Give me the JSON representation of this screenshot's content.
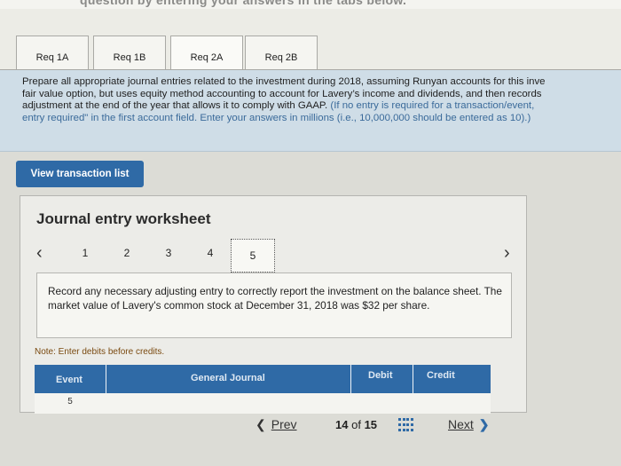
{
  "top_banner": {
    "text": "question by entering your answers in the tabs below."
  },
  "tabs": [
    {
      "label": "Req 1A"
    },
    {
      "label": "Req 1B"
    },
    {
      "label": "Req 2A"
    },
    {
      "label": "Req 2B"
    }
  ],
  "instructions": {
    "line1": "Prepare all appropriate journal entries related to the investment during 2018, assuming Runyan accounts for this inve",
    "line2": "fair value option, but uses equity method accounting to account for Lavery’s income and dividends, and then records",
    "line3": "adjustment at the end of the year that allows it to comply with GAAP.",
    "line3_hl": "(If no entry is required for a transaction/event,",
    "line4_hl": "entry required\" in the first account field. Enter your answers in millions (i.e., 10,000,000 should be entered as 10).)"
  },
  "view_button": {
    "label": "View transaction list"
  },
  "worksheet": {
    "title": "Journal entry worksheet",
    "pages": [
      "1",
      "2",
      "3",
      "4",
      "5"
    ],
    "description": "Record any necessary adjusting entry to correctly report the investment on the balance sheet. The market value of Lavery's common stock at December 31, 2018 was $32 per share.",
    "note": "Note: Enter debits before credits.",
    "table": {
      "headers": {
        "event": "Event",
        "general_journal": "General Journal",
        "debit": "Debit",
        "credit": "Credit"
      },
      "rows": [
        {
          "event": "5"
        }
      ]
    }
  },
  "footer": {
    "prev": "Prev",
    "current": "14",
    "of": "of",
    "total": "15",
    "next": "Next"
  }
}
